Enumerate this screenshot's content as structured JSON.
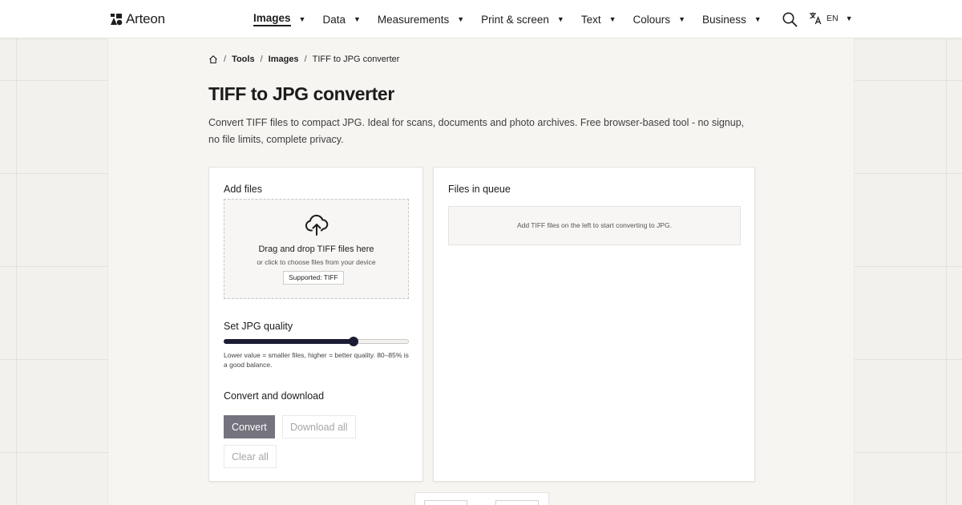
{
  "brand": {
    "name": "Arteon"
  },
  "nav": {
    "items": [
      {
        "label": "Images",
        "active": true
      },
      {
        "label": "Data"
      },
      {
        "label": "Measurements"
      },
      {
        "label": "Print & screen"
      },
      {
        "label": "Text"
      },
      {
        "label": "Colours"
      },
      {
        "label": "Business"
      }
    ],
    "caret": "▼",
    "language": "EN",
    "icons": {
      "search": "search-icon",
      "language": "translate-icon",
      "home": "home-icon",
      "upload": "cloud-upload-icon"
    }
  },
  "breadcrumb": {
    "sep": "/",
    "items": [
      {
        "label": "Tools"
      },
      {
        "label": "Images"
      },
      {
        "label": "TIFF to JPG converter"
      }
    ]
  },
  "page": {
    "title": "TIFF to JPG converter",
    "description": "Convert TIFF files to compact JPG. Ideal for scans, documents and photo archives. Free browser-based tool - no signup, no file limits, complete privacy."
  },
  "add_files": {
    "title": "Add files",
    "drop_title": "Drag and drop TIFF files here",
    "drop_subtitle": "or click to choose files from your device",
    "supported": "Supported: TIFF"
  },
  "quality": {
    "title": "Set JPG quality",
    "value_fraction": 0.7,
    "hint": "Lower value = smaller files, higher = better quality. 80–85% is a good balance."
  },
  "actions": {
    "title": "Convert and download",
    "convert": "Convert",
    "download_all": "Download all",
    "clear_all": "Clear all"
  },
  "queue": {
    "title": "Files in queue",
    "empty": "Add TIFF files on the left to start converting to JPG."
  },
  "colors": {
    "accent": "#1b1b33",
    "primary_button": "#74737e",
    "background": "#f3f1ee"
  }
}
